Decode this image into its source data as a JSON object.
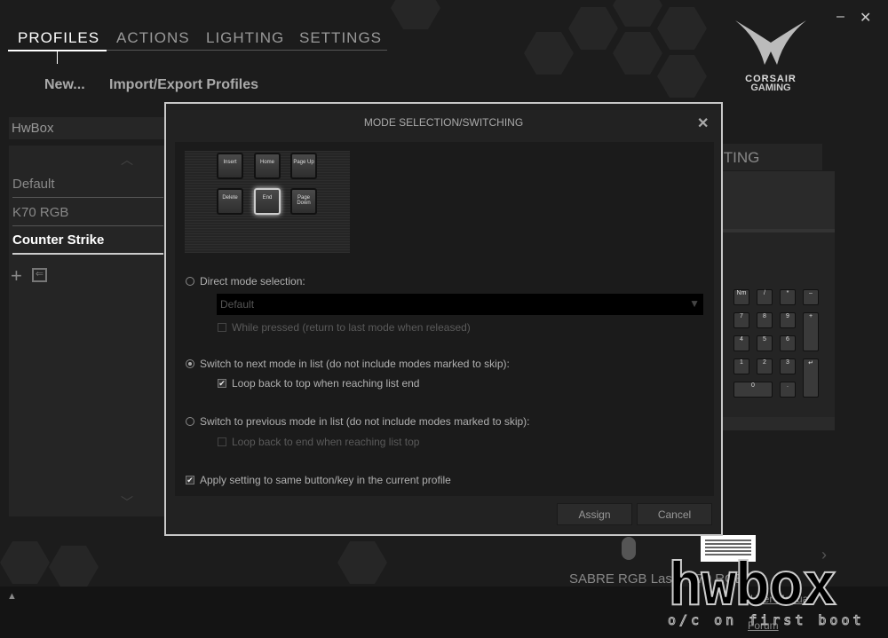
{
  "nav": {
    "tabs": [
      {
        "label": "PROFILES",
        "active": true
      },
      {
        "label": "ACTIONS"
      },
      {
        "label": "LIGHTING"
      },
      {
        "label": "SETTINGS"
      }
    ]
  },
  "toolbar": {
    "new_label": "New...",
    "import_export_label": "Import/Export Profiles"
  },
  "window": {
    "minimize": "–",
    "close": "✕"
  },
  "brand": {
    "logo_text": "CORSAIR",
    "logo_sub": "GAMING"
  },
  "sidebar": {
    "header": "HwBox",
    "profiles": [
      {
        "label": "Default"
      },
      {
        "label": "K70 RGB"
      },
      {
        "label": "Counter Strike",
        "selected": true
      }
    ]
  },
  "background_panel": {
    "tab_label": "ITING",
    "devices_label": "SABRE RGB Laser  K70 RGB",
    "user_manual": "User Manual",
    "forum": "Forum"
  },
  "dialog": {
    "title": "MODE SELECTION/SWITCHING",
    "keys": [
      "Insert",
      "Home",
      "Page Up",
      "Delete",
      "End",
      "Page Down"
    ],
    "direct_label": "Direct mode selection:",
    "direct_selected": false,
    "dropdown_value": "Default",
    "while_pressed": "While pressed (return to last mode when released)",
    "while_pressed_checked": false,
    "next_label": "Switch to next mode in list (do not include modes marked to skip):",
    "next_selected": true,
    "loop_top": "Loop back to top when reaching list end",
    "loop_top_checked": true,
    "prev_label": "Switch to previous mode in list (do not include modes marked to skip):",
    "prev_selected": false,
    "loop_end": "Loop back to end when reaching list top",
    "loop_end_checked": false,
    "apply_label": "Apply setting to same button/key in the current profile",
    "apply_checked": true,
    "assign": "Assign",
    "cancel": "Cancel",
    "close": "✕"
  },
  "watermark": {
    "text": "hwbox",
    "tagline": "o/c on first boot"
  }
}
